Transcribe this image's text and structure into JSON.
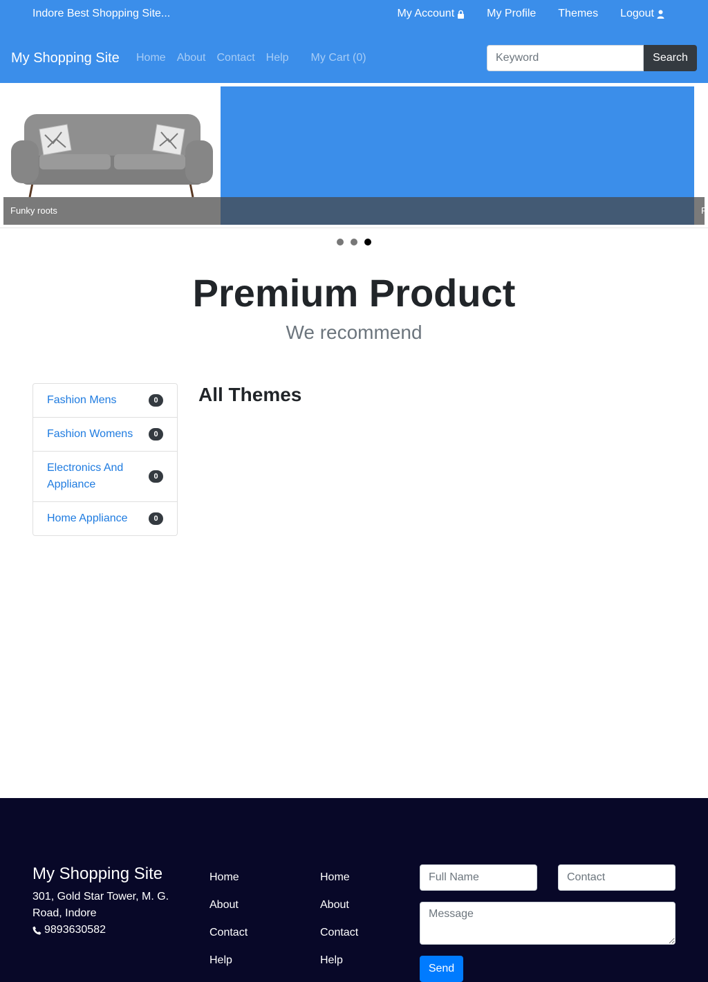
{
  "topbar": {
    "tagline": "Indore Best Shopping Site...",
    "links": {
      "account": "My Account",
      "profile": "My Profile",
      "themes": "Themes",
      "logout": "Logout"
    }
  },
  "navbar": {
    "brand": "My Shopping Site",
    "items": {
      "home": "Home",
      "about": "About",
      "contact": "Contact",
      "help": "Help",
      "cart": "My Cart (0)"
    },
    "search": {
      "placeholder": "Keyword",
      "button": "Search"
    }
  },
  "carousel": {
    "caption": "Funky roots",
    "caption_peek": "F",
    "slide_count": 3,
    "active_index": 2
  },
  "hero": {
    "title": "Premium Product",
    "subtitle": "We recommend"
  },
  "categories": [
    {
      "label": "Fashion Mens",
      "count": "0"
    },
    {
      "label": "Fashion Womens",
      "count": "0"
    },
    {
      "label": "Electronics And Appliance",
      "count": "0"
    },
    {
      "label": "Home Appliance",
      "count": "0"
    }
  ],
  "main": {
    "title": "All Themes"
  },
  "footer": {
    "brand": "My Shopping Site",
    "address": "301, Gold Star Tower, M. G. Road, Indore",
    "phone": "9893630582",
    "col1": [
      "Home",
      "About",
      "Contact",
      "Help"
    ],
    "col2": [
      "Home",
      "About",
      "Contact",
      "Help"
    ],
    "form": {
      "name_placeholder": "Full Name",
      "contact_placeholder": "Contact",
      "message_placeholder": "Message",
      "send": "Send"
    }
  },
  "colors": {
    "header_bg": "#3b8eea",
    "footer_bg": "#080828",
    "link": "#1e7be0",
    "primary_button": "#007bff"
  }
}
